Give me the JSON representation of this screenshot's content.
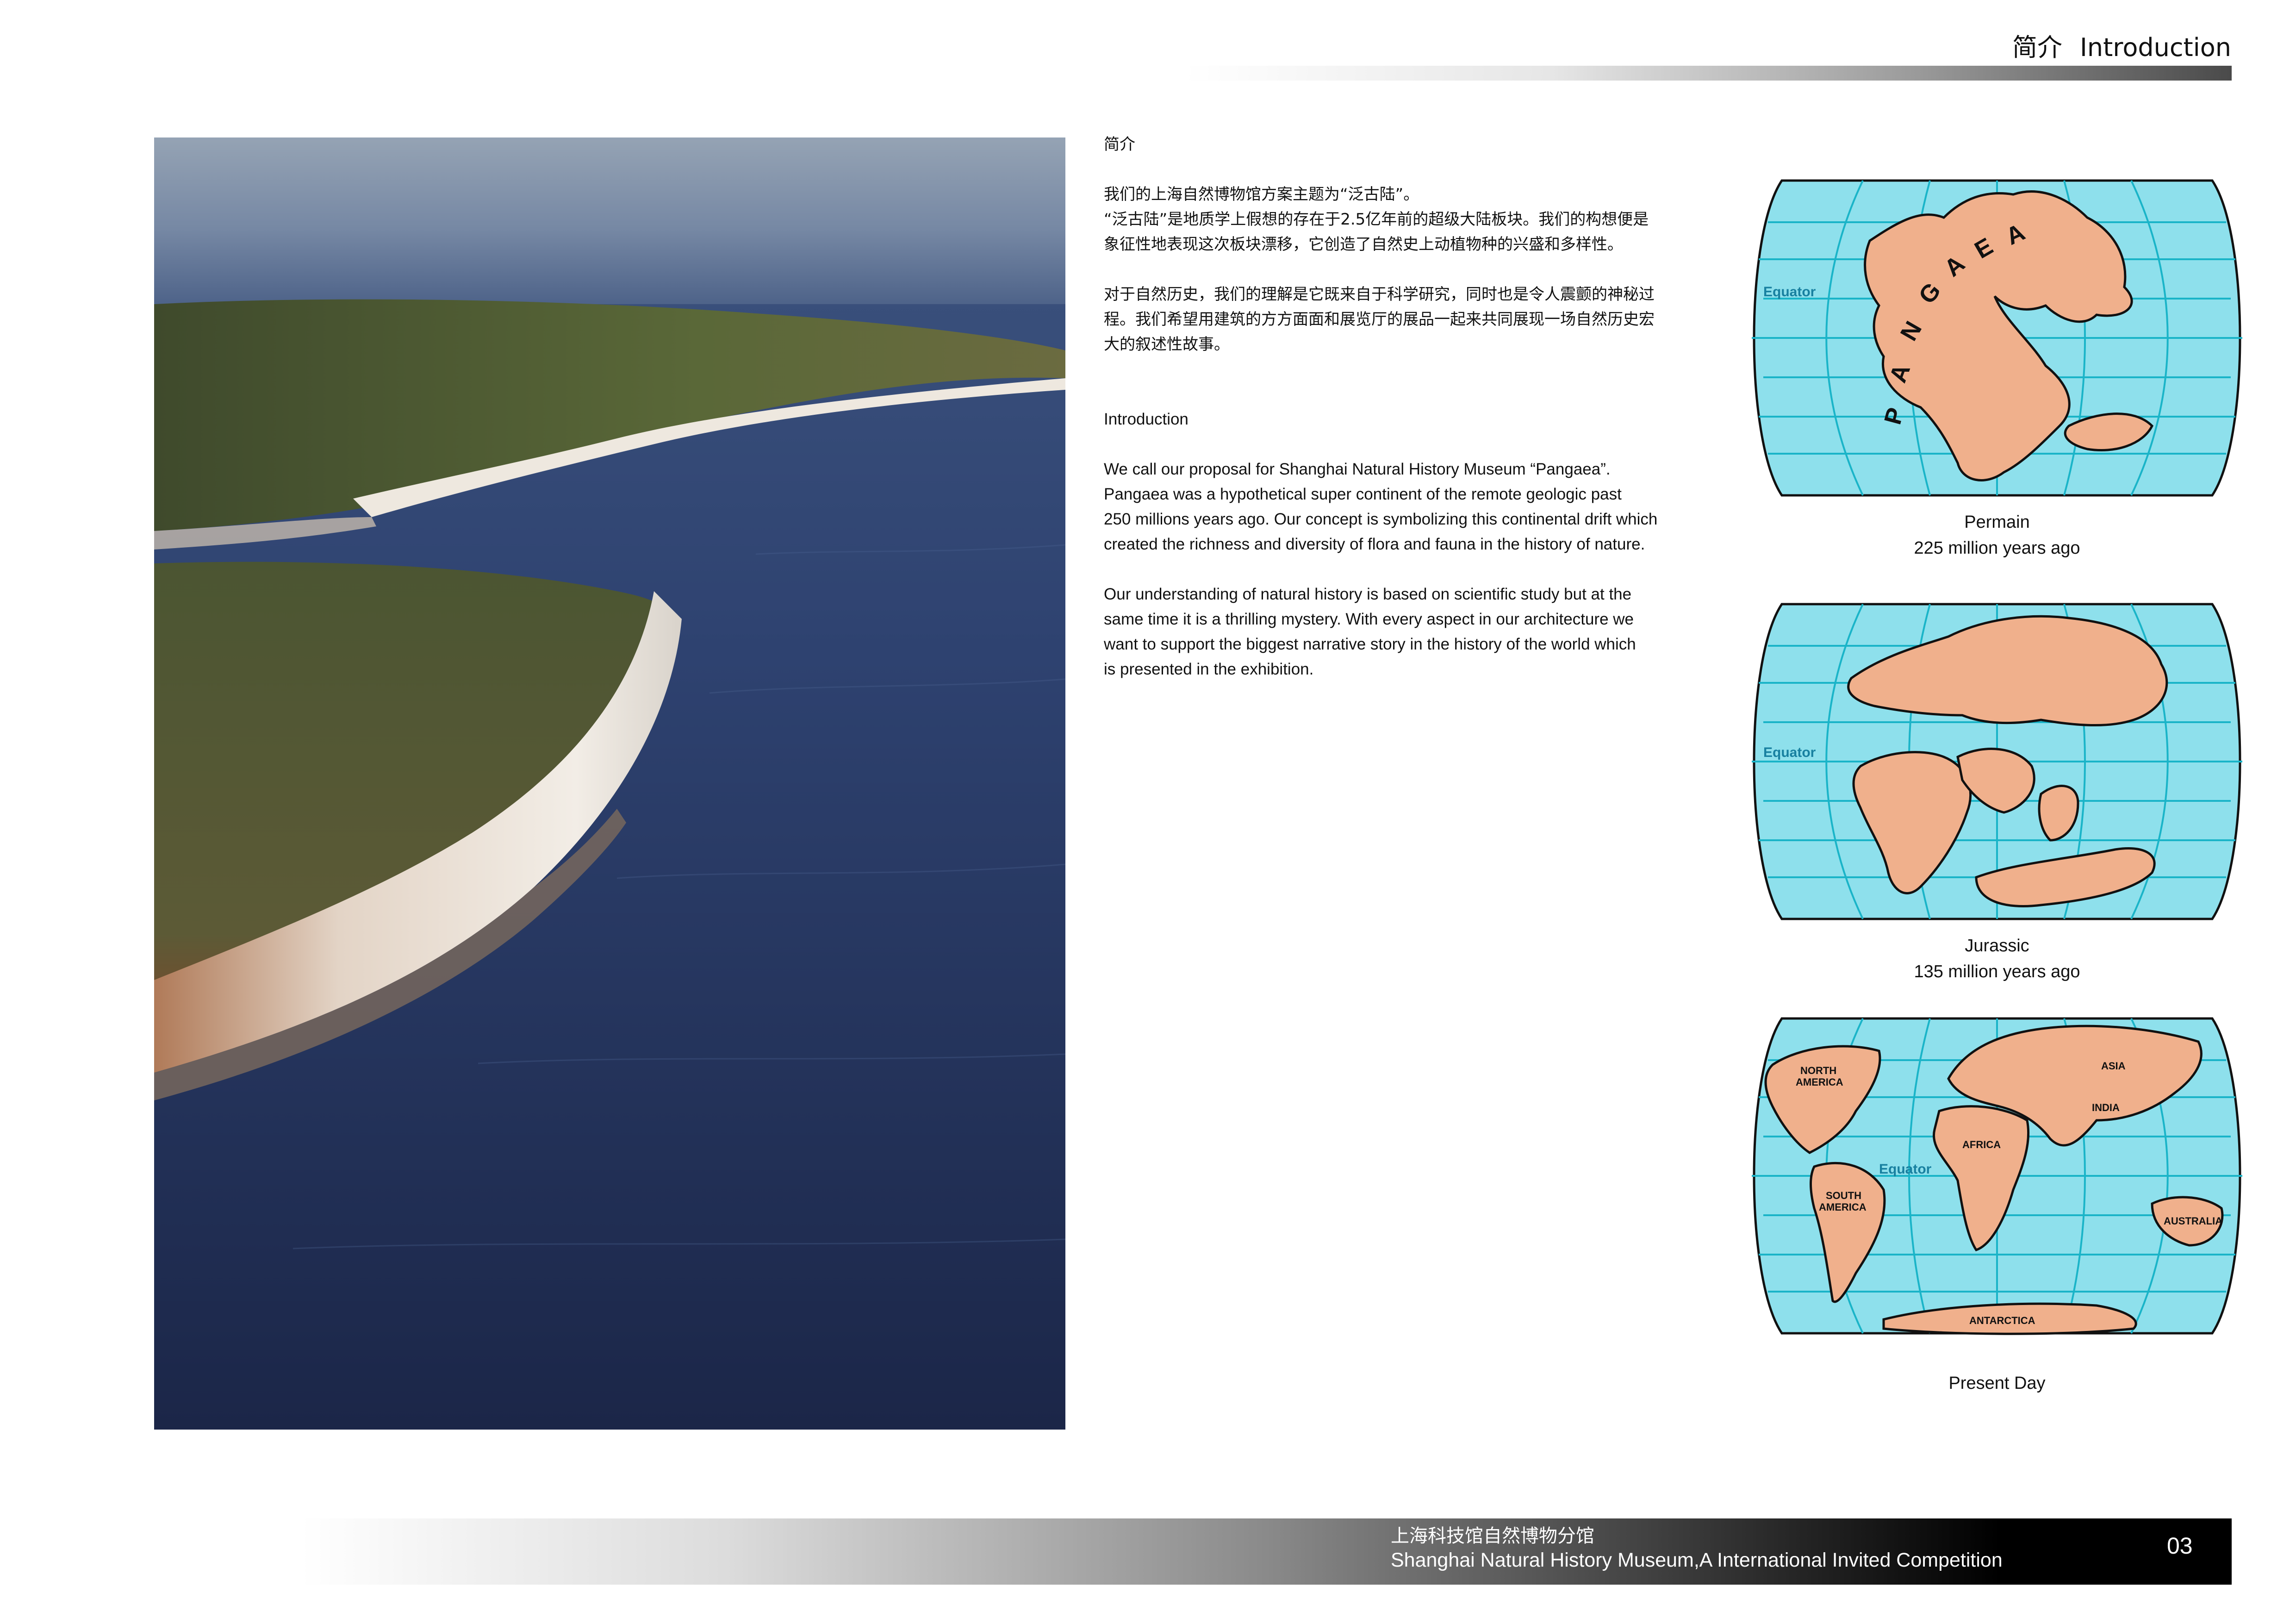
{
  "header": {
    "title_zh": "简介",
    "title_en": "Introduction"
  },
  "text": {
    "zh_heading": "简介",
    "zh_p1_l1": "我们的上海自然博物馆方案主题为“泛古陆”。",
    "zh_p1_l2": "“泛古陆”是地质学上假想的存在于2.5亿年前的超级大陆板块。我们的构想便是",
    "zh_p1_l3": "象征性地表现这次板块漂移，它创造了自然史上动植物种的兴盛和多样性。",
    "zh_p2_l1": "对于自然历史，我们的理解是它既来自于科学研究，同时也是令人震颤的神秘过",
    "zh_p2_l2": "程。我们希望用建筑的方方面面和展览厅的展品一起来共同展现一场自然历史宏",
    "zh_p2_l3": "大的叙述性故事。",
    "en_heading": "Introduction",
    "en_p1_l1": "We call our proposal for Shanghai Natural History Museum “Pangaea”.",
    "en_p1_l2": "Pangaea was a hypothetical super continent of the remote geologic past",
    "en_p1_l3": "250 millions years ago. Our concept is symbolizing this continental drift which",
    "en_p1_l4": "created the richness and diversity of flora and fauna in the history of nature.",
    "en_p2_l1": "Our understanding of natural history is based on scientific study but at the",
    "en_p2_l2": "same time it is a thrilling mystery. With every aspect in our architecture we",
    "en_p2_l3": "want to support the biggest narrative story in the history of the world which",
    "en_p2_l4": "is presented in the exhibition."
  },
  "maps": [
    {
      "caption_l1": "Permain",
      "caption_l2": "225 million years ago",
      "labels": {
        "equator": "Equator",
        "p": "P",
        "a1": "A",
        "n": "N",
        "g": "G",
        "a2": "A",
        "e": "E",
        "a3": "A"
      }
    },
    {
      "caption_l1": "Jurassic",
      "caption_l2": "135 million years ago",
      "labels": {
        "equator": "Equator"
      }
    },
    {
      "caption_l1": "Present Day",
      "labels": {
        "equator": "Equator",
        "north_america_1": "NORTH",
        "north_america_2": "AMERICA",
        "south_america_1": "SOUTH",
        "south_america_2": "AMERICA",
        "africa": "AFRICA",
        "asia": "ASIA",
        "india": "INDIA",
        "australia": "AUSTRALIA",
        "antarctica": "ANTARCTICA"
      }
    }
  ],
  "colors": {
    "ocean": "#8ee0ec",
    "land": "#f0b08c",
    "grid": "#1ab4c8",
    "outline": "#111111"
  },
  "footer": {
    "line_zh": "上海科技馆自然博物分馆",
    "line_en": "Shanghai Natural History Museum,A International Invited Competition",
    "page_number": "03"
  }
}
